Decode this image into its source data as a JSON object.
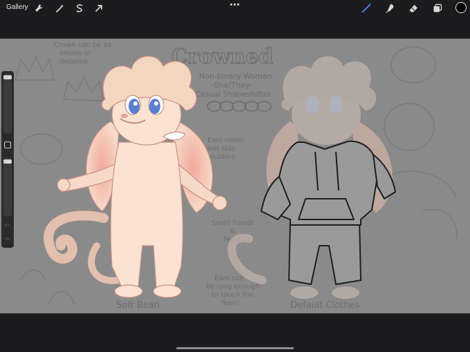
{
  "app": "Procreate",
  "toolbar": {
    "gallery_label": "Gallery",
    "left_tools": [
      "wrench-icon",
      "magic-wand-icon",
      "selection-icon",
      "transform-arrow-icon"
    ],
    "right_tools": [
      "brush-icon",
      "smudge-icon",
      "eraser-icon",
      "layers-icon"
    ],
    "active_tool": "brush-icon",
    "active_color": "#000000",
    "active_tool_color": "#4a8cff"
  },
  "sidebar": {
    "brush_size_level": 0.03,
    "opacity_level": 0.03,
    "modify_icon": "square-icon",
    "undo_icon": "undo-arrow-icon",
    "redo_icon": "redo-arrow-icon"
  },
  "artwork": {
    "title": "Crowned",
    "subtitle_lines": [
      "Non-binary Woman",
      "-She/They-",
      "Casual Shapeshifter"
    ],
    "notes_left": [
      "Crown can be as",
      "ornate or",
      "detailed"
    ],
    "notes_mid": [
      "Ears never",
      "and stay",
      "shoulders"
    ],
    "notes_hands": [
      "Small hands",
      "&",
      "feet!"
    ],
    "notes_ears": [
      "Ears can",
      "be long enough",
      "to touch the",
      "floor!"
    ],
    "caption_left": "Soft Bean",
    "caption_right": "Default Clothes",
    "palette_colors": [
      "#f6d9c9",
      "#f2a99a",
      "#e8c7b3",
      "#fff3ea",
      "#5a7fd0"
    ]
  }
}
